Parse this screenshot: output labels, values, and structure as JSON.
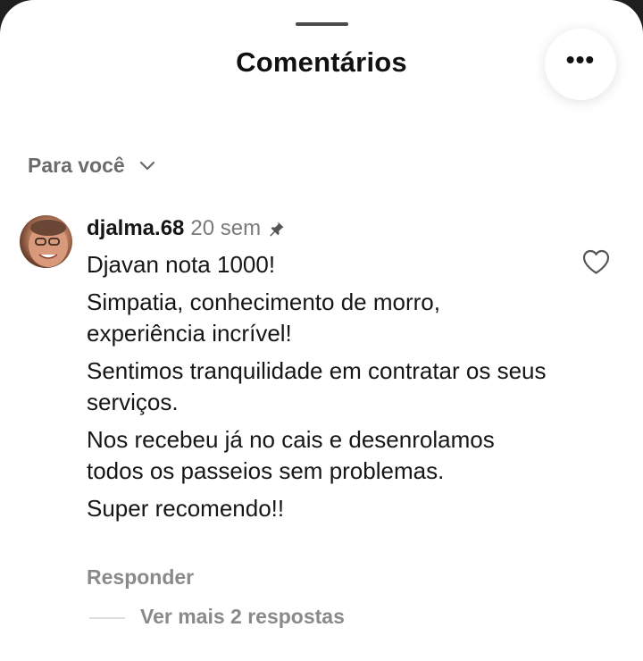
{
  "sheet": {
    "title": "Comentários",
    "more_icon": "more-horizontal-icon"
  },
  "filter": {
    "label": "Para você",
    "icon": "chevron-down-icon"
  },
  "comment": {
    "username": "djalma.68",
    "time": "20 sem",
    "pinned_icon": "pin-icon",
    "paragraphs": [
      "Djavan nota 1000!",
      "Simpatia, conhecimento de morro, experiência incrível!",
      "Sentimos tranquilidade em contratar os seus serviços.",
      "Nos recebeu já no cais e desenrolamos todos os passeios sem problemas.",
      "Super recomendo!!"
    ],
    "reply_label": "Responder",
    "like_icon": "heart-icon",
    "view_replies_label": "Ver mais 2 respostas"
  }
}
